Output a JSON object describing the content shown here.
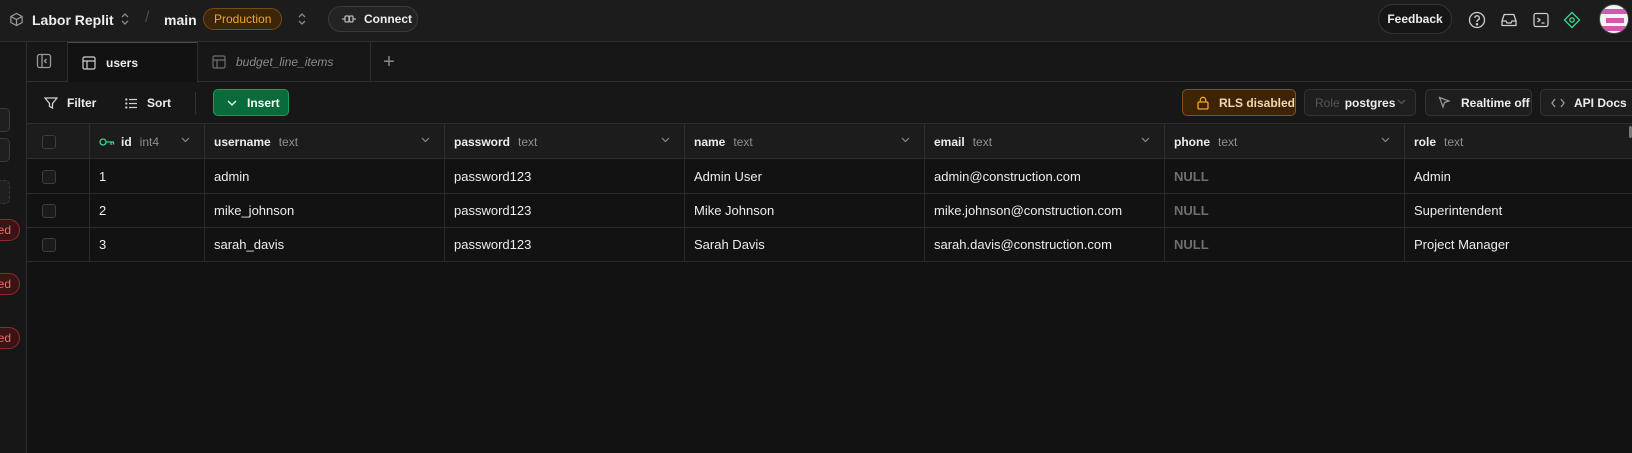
{
  "topbar": {
    "project_name": "Labor Replit",
    "separator": "/",
    "branch_name": "main",
    "environment_badge": "Production",
    "connect_label": "Connect",
    "feedback_label": "Feedback",
    "icons": [
      "help-icon",
      "inbox-icon",
      "terminal-icon",
      "assistant-icon"
    ]
  },
  "left_rail": {
    "badges": [
      "ed",
      "ed",
      "ed"
    ]
  },
  "tabs": [
    {
      "label": "users",
      "active": true
    },
    {
      "label": "budget_line_items",
      "active": false
    }
  ],
  "toolbar": {
    "filter_label": "Filter",
    "sort_label": "Sort",
    "insert_label": "Insert",
    "rls_label": "RLS disabled",
    "role_label": "Role",
    "role_value": "postgres",
    "realtime_label": "Realtime off",
    "api_docs_label": "API Docs"
  },
  "table": {
    "columns": [
      {
        "name": "id",
        "type": "int4",
        "primary_key": true
      },
      {
        "name": "username",
        "type": "text"
      },
      {
        "name": "password",
        "type": "text"
      },
      {
        "name": "name",
        "type": "text"
      },
      {
        "name": "email",
        "type": "text"
      },
      {
        "name": "phone",
        "type": "text"
      },
      {
        "name": "role",
        "type": "text"
      }
    ],
    "rows": [
      [
        "1",
        "admin",
        "password123",
        "Admin User",
        "admin@construction.com",
        "NULL",
        "Admin"
      ],
      [
        "2",
        "mike_johnson",
        "password123",
        "Mike Johnson",
        "mike.johnson@construction.com",
        "NULL",
        "Superintendent"
      ],
      [
        "3",
        "sarah_davis",
        "password123",
        "Sarah Davis",
        "sarah.davis@construction.com",
        "NULL",
        "Project Manager"
      ]
    ]
  },
  "colors": {
    "background": "#121212",
    "accent_green": "#3ecf8e",
    "warning_orange": "#f5a524",
    "danger_red": "#f06a6a"
  }
}
